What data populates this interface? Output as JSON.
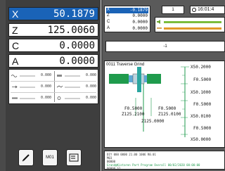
{
  "axes": [
    {
      "label": "X",
      "value": "50.1879",
      "active": true
    },
    {
      "label": "Z",
      "value": "125.0060",
      "active": false
    },
    {
      "label": "C",
      "value": "0.0000",
      "active": false
    },
    {
      "label": "A",
      "value": "0.0000",
      "active": false
    }
  ],
  "overrides": [
    {
      "name": "feed-override",
      "value": "0.000"
    },
    {
      "name": "spindle-override",
      "value": "0.000"
    },
    {
      "name": "rapid-override",
      "value": "0.000"
    },
    {
      "name": "jog-override",
      "value": "0.000"
    },
    {
      "name": "tool-override",
      "value": "0.000"
    },
    {
      "name": "load-override",
      "value": "0.000"
    }
  ],
  "toolbar": {
    "edit_icon": "pencil-icon",
    "m01_label": "M01",
    "optional_icon": "skip-icon"
  },
  "pos_small": [
    {
      "label": "X",
      "value": "-0.1879",
      "active": true
    },
    {
      "label": "Z",
      "value": "0.0000"
    },
    {
      "label": "C",
      "value": "0.0000"
    },
    {
      "label": "A",
      "value": "0.0000"
    }
  ],
  "status": {
    "t_value": "1"
  },
  "clock": {
    "time": "16:01:4"
  },
  "cmd_value": "-1",
  "graphic": {
    "title": "0011 Traverse Grind",
    "left_f1": "F0.5000",
    "left_z1": "Z125.2100",
    "left_f2": "F0.5000",
    "left_z2": "Z125.0100",
    "bottom_z": "Z125.0000",
    "right_labels": [
      "X50.2000",
      "F0.5000",
      "X50.1000",
      "F0.5000",
      "X50.0100",
      "F0.5000",
      "X50.0000"
    ]
  },
  "messages": [
    "DIY 000 0000 21.00 1006 R0.01",
    "M03",
    "00000",
    "Grand@Kistaren Part Program Overall 00/02/2020 00:00:00",
    "00000 S1"
  ],
  "colors": {
    "accent": "#1a63b7",
    "bar_green": "#7dbd3c",
    "bar_orange": "#e39a2a",
    "graph_green": "#1f9b4d"
  }
}
